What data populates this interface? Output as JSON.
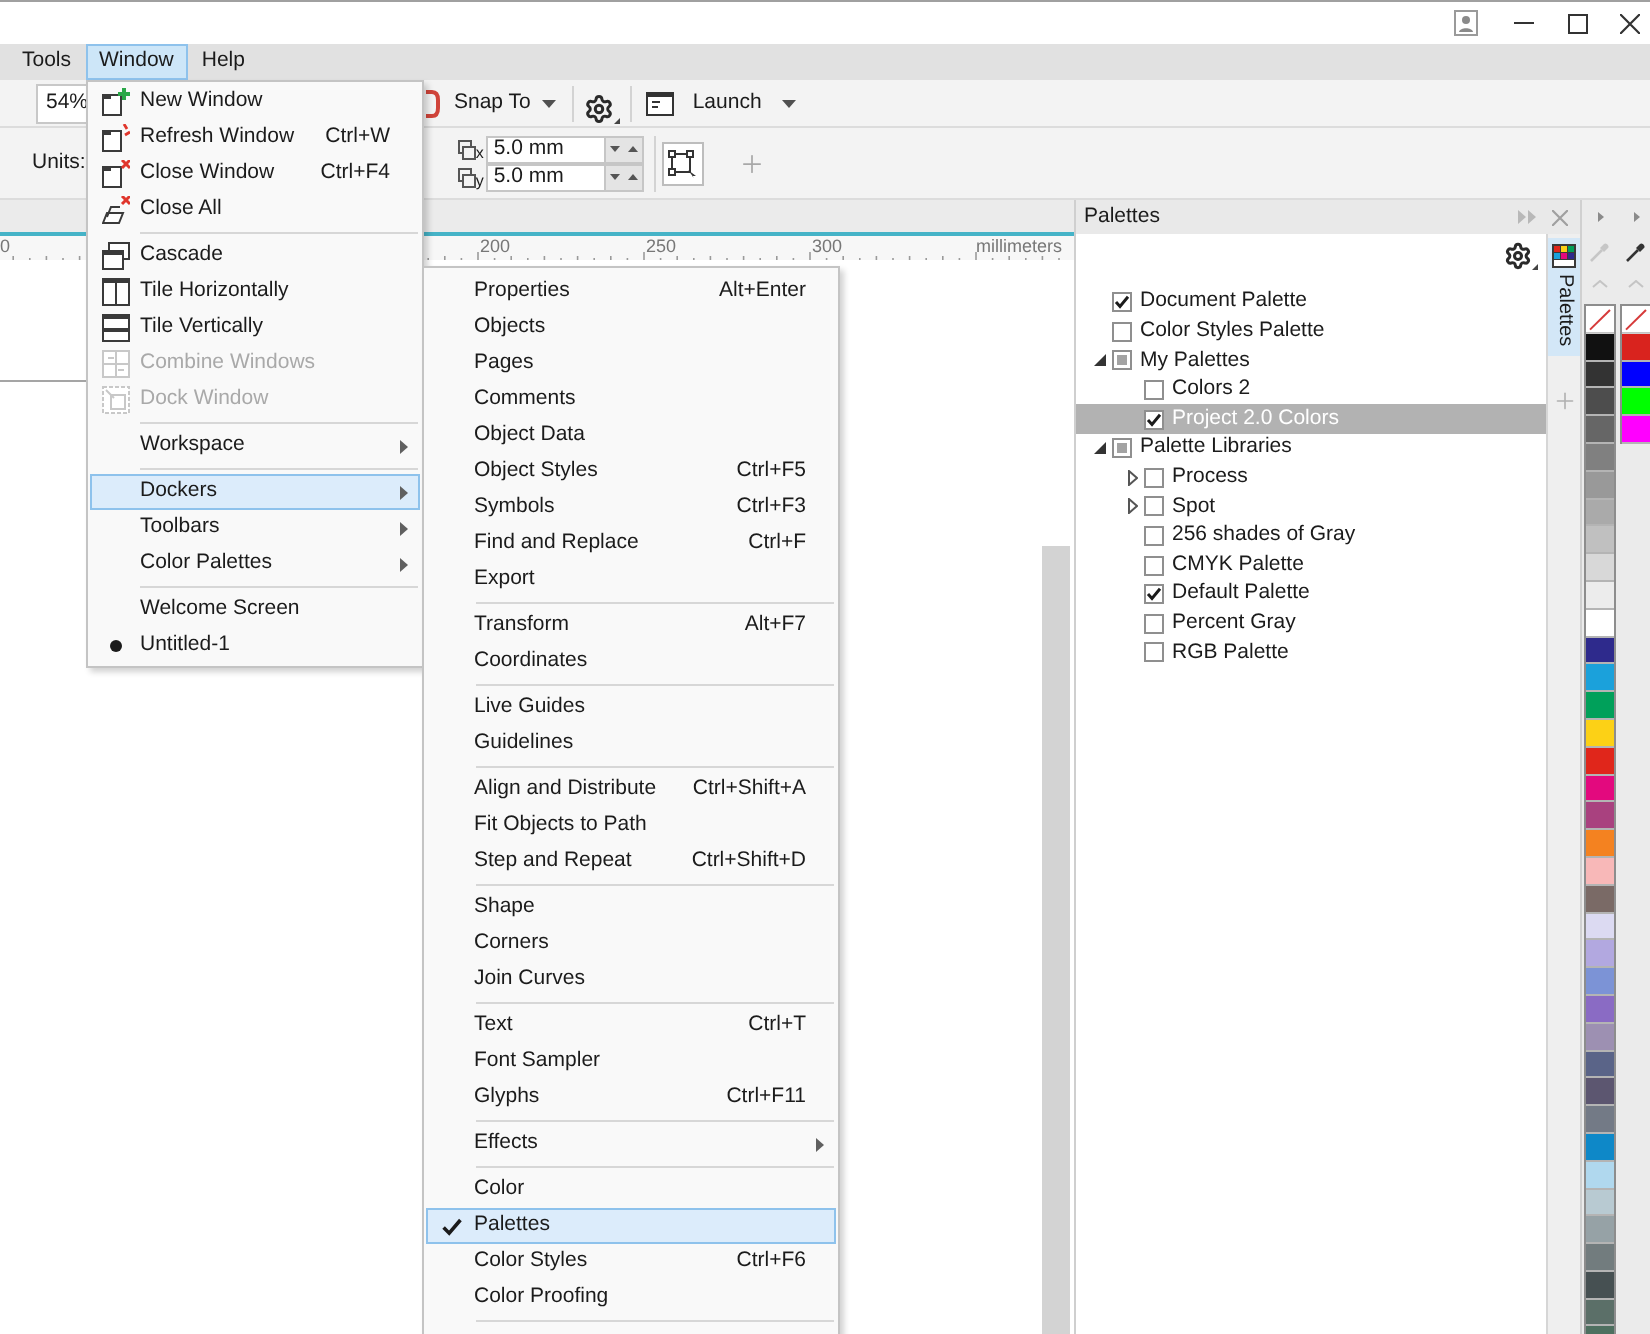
{
  "menu_bar": {
    "items": [
      {
        "label": "Tools",
        "selected": false
      },
      {
        "label": "Window",
        "selected": true
      },
      {
        "label": "Help",
        "selected": false
      }
    ]
  },
  "property_bar": {
    "zoom": "54%",
    "snap_to": "Snap To",
    "launch": "Launch"
  },
  "nudge_bar": {
    "units_label": "Units:",
    "rows": [
      {
        "axis": "x",
        "value": "5.0 mm"
      },
      {
        "axis": "y",
        "value": "5.0 mm"
      }
    ]
  },
  "ruler": {
    "edge_label": "0",
    "labels": [
      "200",
      "250",
      "300"
    ],
    "unit": "millimeters"
  },
  "window_menu": {
    "continues": false,
    "groups": [
      {
        "items": [
          {
            "label": "New Window",
            "kind": "command",
            "selected": false,
            "disabled": false,
            "checked": false
          },
          {
            "label": "Refresh Window",
            "shortcut": "Ctrl+W",
            "kind": "command",
            "selected": false,
            "disabled": false,
            "checked": false
          },
          {
            "label": "Close Window",
            "shortcut": "Ctrl+F4",
            "kind": "command",
            "selected": false,
            "disabled": false,
            "checked": false
          },
          {
            "label": "Close All",
            "kind": "command",
            "selected": false,
            "disabled": false,
            "checked": false
          }
        ]
      },
      {
        "items": [
          {
            "label": "Cascade",
            "kind": "command",
            "selected": false,
            "disabled": false,
            "checked": false
          },
          {
            "label": "Tile Horizontally",
            "kind": "command",
            "selected": false,
            "disabled": false,
            "checked": false
          },
          {
            "label": "Tile Vertically",
            "kind": "command",
            "selected": false,
            "disabled": false,
            "checked": false
          },
          {
            "label": "Combine Windows",
            "kind": "command",
            "selected": false,
            "disabled": true,
            "checked": false
          },
          {
            "label": "Dock Window",
            "kind": "command",
            "selected": false,
            "disabled": true,
            "checked": false
          }
        ]
      },
      {
        "items": [
          {
            "label": "Workspace",
            "kind": "submenu",
            "selected": false,
            "disabled": false,
            "checked": false
          }
        ]
      },
      {
        "items": [
          {
            "label": "Dockers",
            "kind": "submenu",
            "selected": true,
            "disabled": false,
            "checked": false
          },
          {
            "label": "Toolbars",
            "kind": "submenu",
            "selected": false,
            "disabled": false,
            "checked": false
          },
          {
            "label": "Color Palettes",
            "kind": "submenu",
            "selected": false,
            "disabled": false,
            "checked": false
          }
        ]
      },
      {
        "items": [
          {
            "label": "Welcome Screen",
            "kind": "command",
            "selected": false,
            "disabled": false,
            "checked": false
          },
          {
            "label": "Untitled-1",
            "kind": "radio",
            "selected": false,
            "disabled": false,
            "checked": true
          }
        ]
      }
    ]
  },
  "dockers_menu": {
    "continues": true,
    "groups": [
      {
        "items": [
          {
            "label": "Properties",
            "shortcut": "Alt+Enter",
            "kind": "command",
            "selected": false,
            "disabled": false,
            "checked": false
          },
          {
            "label": "Objects",
            "kind": "command",
            "selected": false,
            "disabled": false,
            "checked": false
          },
          {
            "label": "Pages",
            "kind": "command",
            "selected": false,
            "disabled": false,
            "checked": false
          },
          {
            "label": "Comments",
            "kind": "command",
            "selected": false,
            "disabled": false,
            "checked": false
          },
          {
            "label": "Object Data",
            "kind": "command",
            "selected": false,
            "disabled": false,
            "checked": false
          },
          {
            "label": "Object Styles",
            "shortcut": "Ctrl+F5",
            "kind": "command",
            "selected": false,
            "disabled": false,
            "checked": false
          },
          {
            "label": "Symbols",
            "shortcut": "Ctrl+F3",
            "kind": "command",
            "selected": false,
            "disabled": false,
            "checked": false
          },
          {
            "label": "Find and Replace",
            "shortcut": "Ctrl+F",
            "kind": "command",
            "selected": false,
            "disabled": false,
            "checked": false
          },
          {
            "label": "Export",
            "kind": "command",
            "selected": false,
            "disabled": false,
            "checked": false
          }
        ]
      },
      {
        "items": [
          {
            "label": "Transform",
            "shortcut": "Alt+F7",
            "kind": "command",
            "selected": false,
            "disabled": false,
            "checked": false
          },
          {
            "label": "Coordinates",
            "kind": "command",
            "selected": false,
            "disabled": false,
            "checked": false
          }
        ]
      },
      {
        "items": [
          {
            "label": "Live Guides",
            "kind": "command",
            "selected": false,
            "disabled": false,
            "checked": false
          },
          {
            "label": "Guidelines",
            "kind": "command",
            "selected": false,
            "disabled": false,
            "checked": false
          }
        ]
      },
      {
        "items": [
          {
            "label": "Align and Distribute",
            "shortcut": "Ctrl+Shift+A",
            "kind": "command",
            "selected": false,
            "disabled": false,
            "checked": false
          },
          {
            "label": "Fit Objects to Path",
            "kind": "command",
            "selected": false,
            "disabled": false,
            "checked": false
          },
          {
            "label": "Step and Repeat",
            "shortcut": "Ctrl+Shift+D",
            "kind": "command",
            "selected": false,
            "disabled": false,
            "checked": false
          }
        ]
      },
      {
        "items": [
          {
            "label": "Shape",
            "kind": "command",
            "selected": false,
            "disabled": false,
            "checked": false
          },
          {
            "label": "Corners",
            "kind": "command",
            "selected": false,
            "disabled": false,
            "checked": false
          },
          {
            "label": "Join Curves",
            "kind": "command",
            "selected": false,
            "disabled": false,
            "checked": false
          }
        ]
      },
      {
        "items": [
          {
            "label": "Text",
            "shortcut": "Ctrl+T",
            "kind": "command",
            "selected": false,
            "disabled": false,
            "checked": false
          },
          {
            "label": "Font Sampler",
            "kind": "command",
            "selected": false,
            "disabled": false,
            "checked": false
          },
          {
            "label": "Glyphs",
            "shortcut": "Ctrl+F11",
            "kind": "command",
            "selected": false,
            "disabled": false,
            "checked": false
          }
        ]
      },
      {
        "items": [
          {
            "label": "Effects",
            "kind": "submenu",
            "selected": false,
            "disabled": false,
            "checked": false
          }
        ]
      },
      {
        "items": [
          {
            "label": "Color",
            "kind": "command",
            "selected": false,
            "disabled": false,
            "checked": false
          },
          {
            "label": "Palettes",
            "kind": "command",
            "selected": true,
            "disabled": false,
            "checked": true
          },
          {
            "label": "Color Styles",
            "shortcut": "Ctrl+F6",
            "kind": "command",
            "selected": false,
            "disabled": false,
            "checked": false
          },
          {
            "label": "Color Proofing",
            "kind": "command",
            "selected": false,
            "disabled": false,
            "checked": false
          }
        ]
      }
    ]
  },
  "docker": {
    "title": "Palettes",
    "tab": {
      "label": "Palettes",
      "selected": true
    },
    "tree": [
      {
        "label": "Document Palette",
        "checked": true,
        "indeterminate": false,
        "selected": false
      },
      {
        "label": "Color Styles Palette",
        "checked": false,
        "indeterminate": false,
        "selected": false
      },
      {
        "label": "My Palettes",
        "checked": false,
        "indeterminate": true,
        "selected": false,
        "expanded": true,
        "children": [
          {
            "label": "Colors 2",
            "checked": false,
            "indeterminate": false,
            "selected": false
          },
          {
            "label": "Project 2.0 Colors",
            "checked": true,
            "indeterminate": false,
            "selected": true
          }
        ]
      },
      {
        "label": "Palette Libraries",
        "checked": false,
        "indeterminate": true,
        "selected": false,
        "expanded": true,
        "children": [
          {
            "label": "Process",
            "checked": false,
            "indeterminate": false,
            "selected": false,
            "expanded": false
          },
          {
            "label": "Spot",
            "checked": false,
            "indeterminate": false,
            "selected": false,
            "expanded": false
          },
          {
            "label": "256 shades of Gray",
            "checked": false,
            "indeterminate": false,
            "selected": false
          },
          {
            "label": "CMYK Palette",
            "checked": false,
            "indeterminate": false,
            "selected": false
          },
          {
            "label": "Default Palette",
            "checked": true,
            "indeterminate": false,
            "selected": false
          },
          {
            "label": "Percent Gray",
            "checked": false,
            "indeterminate": false,
            "selected": false
          },
          {
            "label": "RGB Palette",
            "checked": false,
            "indeterminate": false,
            "selected": false
          }
        ]
      }
    ]
  },
  "color_palettes": [
    {
      "picker_disabled": true,
      "swatches": [
        {
          "kind": "none"
        },
        {
          "kind": "color",
          "color": "#111111"
        },
        {
          "kind": "color",
          "color": "#333333"
        },
        {
          "kind": "color",
          "color": "#4d4d4d"
        },
        {
          "kind": "color",
          "color": "#666666"
        },
        {
          "kind": "color",
          "color": "#808080"
        },
        {
          "kind": "color",
          "color": "#999999"
        },
        {
          "kind": "color",
          "color": "#aaaaaa"
        },
        {
          "kind": "color",
          "color": "#c0c0c0"
        },
        {
          "kind": "color",
          "color": "#d8d8d8"
        },
        {
          "kind": "color",
          "color": "#ececec"
        },
        {
          "kind": "color",
          "color": "#ffffff"
        },
        {
          "kind": "color",
          "color": "#2e2a8c"
        },
        {
          "kind": "color",
          "color": "#1ba1db"
        },
        {
          "kind": "color",
          "color": "#00a05a"
        },
        {
          "kind": "color",
          "color": "#fcd116"
        },
        {
          "kind": "color",
          "color": "#e0261b"
        },
        {
          "kind": "color",
          "color": "#e3097e"
        },
        {
          "kind": "color",
          "color": "#a9417f"
        },
        {
          "kind": "color",
          "color": "#f48220"
        },
        {
          "kind": "color",
          "color": "#f8b8b8"
        },
        {
          "kind": "color",
          "color": "#7a6a66"
        },
        {
          "kind": "color",
          "color": "#dcdaf2"
        },
        {
          "kind": "color",
          "color": "#b2a8e0"
        },
        {
          "kind": "color",
          "color": "#7c93d6"
        },
        {
          "kind": "color",
          "color": "#8a6bc4"
        },
        {
          "kind": "color",
          "color": "#9d90b2"
        },
        {
          "kind": "color",
          "color": "#5a6488"
        },
        {
          "kind": "color",
          "color": "#5c5670"
        },
        {
          "kind": "color",
          "color": "#737a86"
        },
        {
          "kind": "color",
          "color": "#0e88c8"
        },
        {
          "kind": "color",
          "color": "#b0d8ee"
        },
        {
          "kind": "color",
          "color": "#b8cad2"
        },
        {
          "kind": "color",
          "color": "#96a2a6"
        },
        {
          "kind": "color",
          "color": "#727c7e"
        },
        {
          "kind": "color",
          "color": "#465052"
        },
        {
          "kind": "color",
          "color": "#5b6f68"
        },
        {
          "kind": "color",
          "color": "#4e7060"
        }
      ]
    },
    {
      "picker_disabled": false,
      "swatches": [
        {
          "kind": "none"
        },
        {
          "kind": "color",
          "color": "#d9231e"
        },
        {
          "kind": "color",
          "color": "#0000ff"
        },
        {
          "kind": "color",
          "color": "#00ff00"
        },
        {
          "kind": "color",
          "color": "#ff00ff"
        }
      ]
    }
  ]
}
